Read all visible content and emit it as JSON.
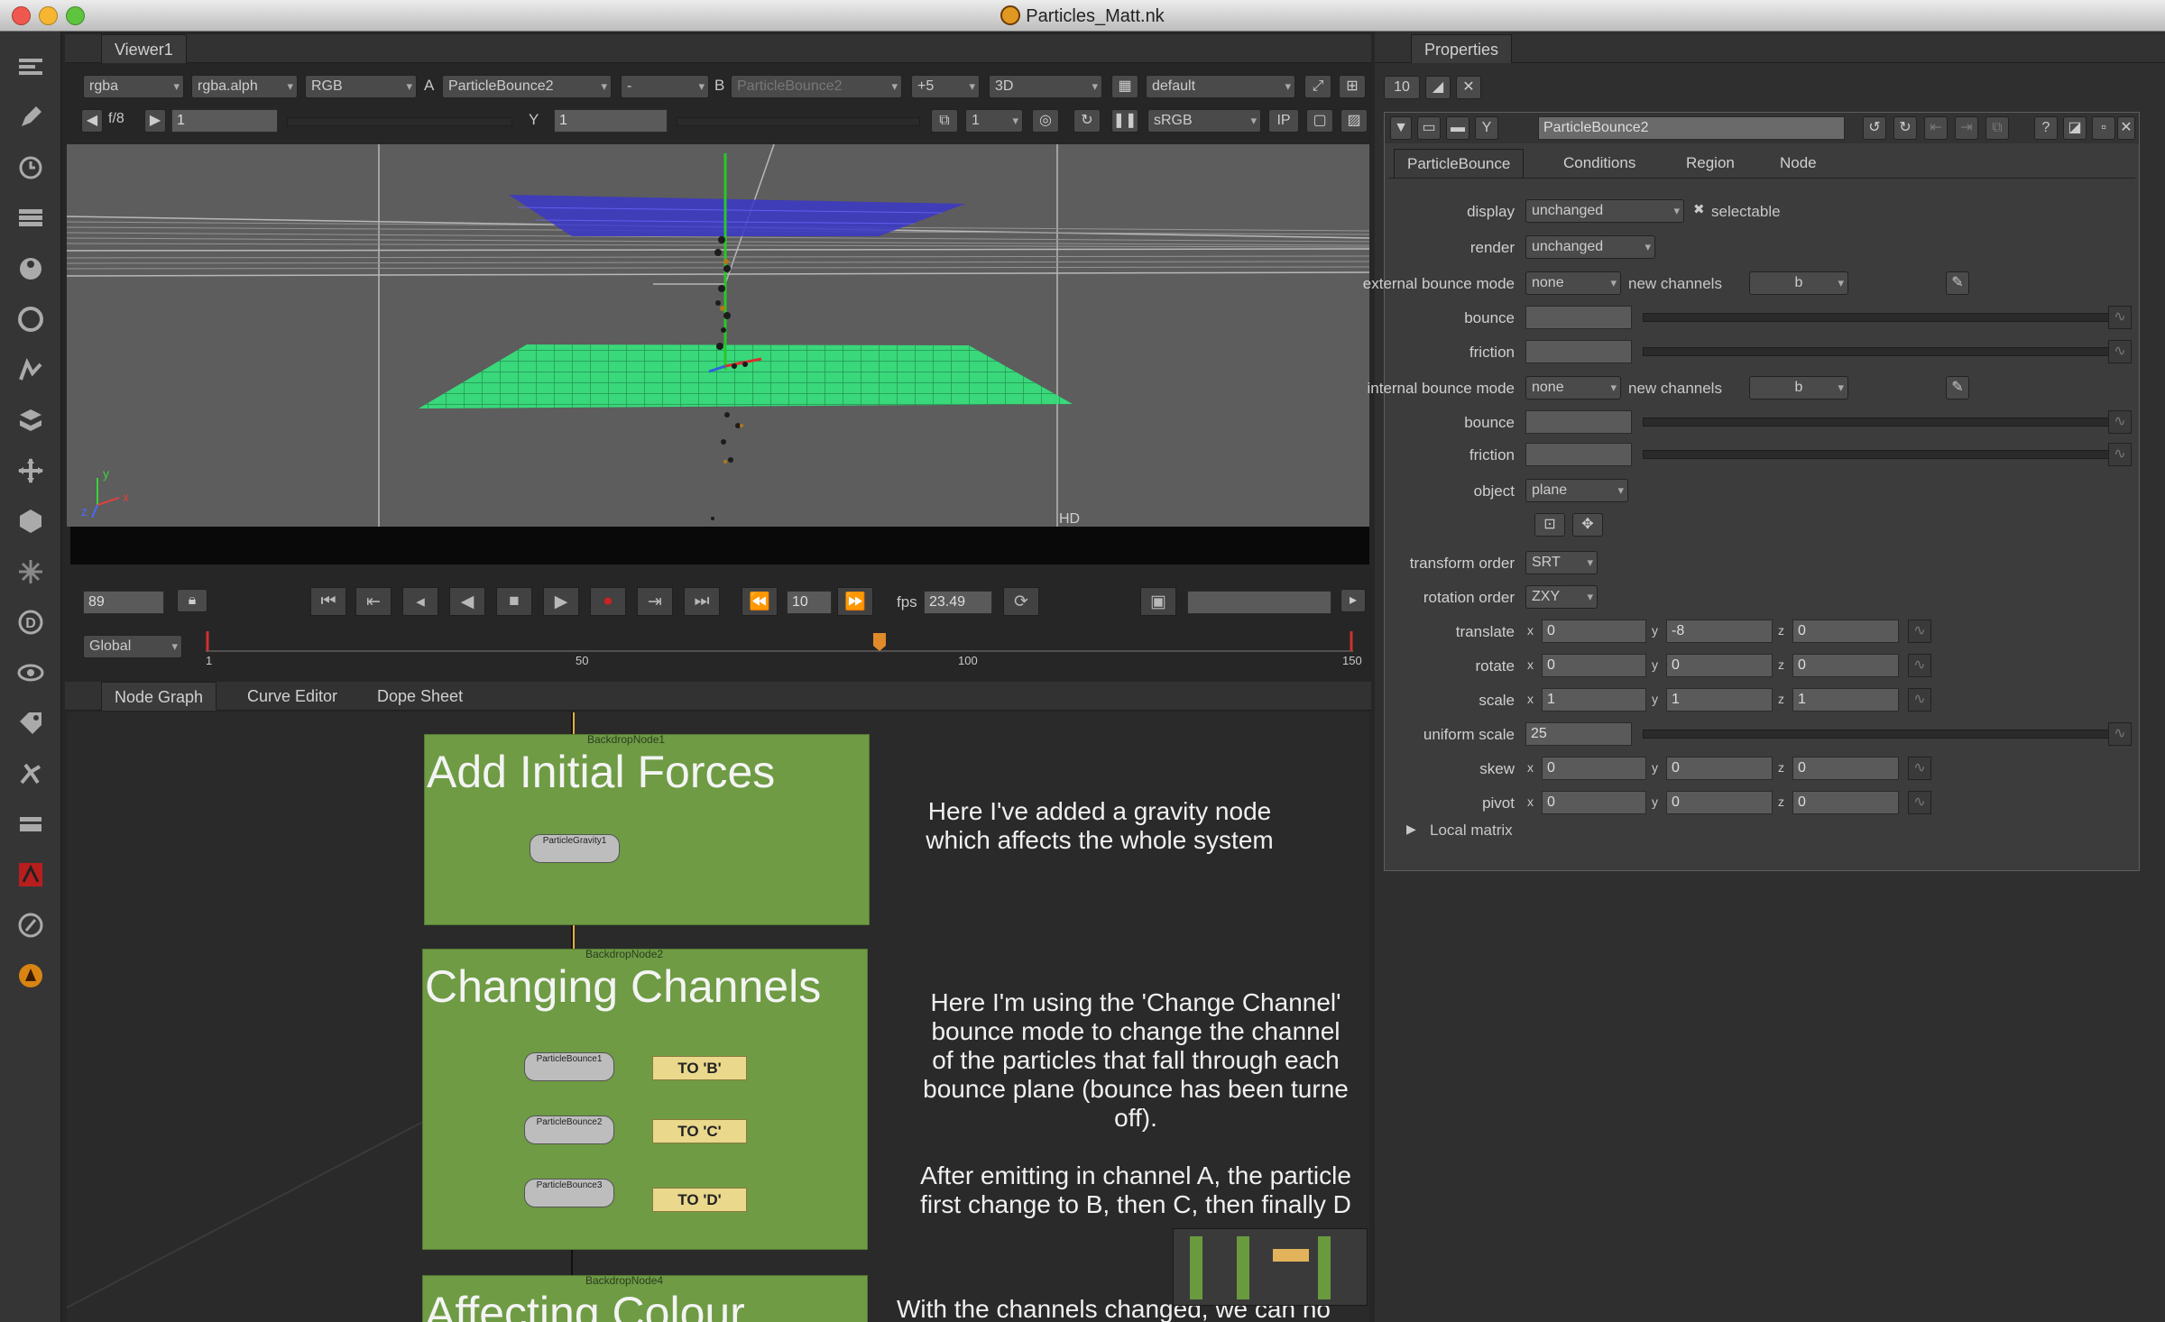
{
  "window": {
    "title": "Particles_Matt.nk"
  },
  "viewer": {
    "tab": "Viewer1",
    "channels": "rgba",
    "alpha_channel": "rgba.alph",
    "display": "RGB",
    "a_label": "A",
    "a_input": "ParticleBounce2",
    "compare": "-",
    "b_label": "B",
    "b_input": "ParticleBounce2",
    "zoom": "+5",
    "view_mode": "3D",
    "lut_preset": "default",
    "frame_fraction": "f/8",
    "gain": "1",
    "y_label": "Y",
    "gamma": "1",
    "proxy": "1",
    "colorspace": "sRGB",
    "ip_label": "IP",
    "format_label": "HD"
  },
  "timeline": {
    "current_frame": "89",
    "increment": "10",
    "fps_label": "fps",
    "fps": "23.49",
    "range": "Global",
    "ticks": [
      "1",
      "50",
      "100",
      "150"
    ]
  },
  "nodegraph": {
    "tabs": [
      "Node Graph",
      "Curve Editor",
      "Dope Sheet"
    ],
    "backdrops": [
      {
        "title": "Add Initial Forces",
        "label": "BackdropNode1"
      },
      {
        "title": "Changing Channels",
        "label": "BackdropNode2"
      },
      {
        "title": "Affecting Colour",
        "label": "BackdropNode4"
      }
    ],
    "tags": [
      "TO 'B'",
      "TO 'C'",
      "TO 'D'"
    ],
    "notes": {
      "gravity": "Here I've added a gravity node\nwhich affects the whole system",
      "channels": "Here I'm using the 'Change Channel'\nbounce mode to change the channel\nof the particles that fall through each\nbounce plane (bounce has been turne\noff).\n\nAfter emitting in channel A, the particle\nfirst change to B, then C, then finally D",
      "colour": "With the channels changed, we can no"
    },
    "small_nodes": [
      "ParticleGravity1",
      "ParticleBounce1",
      "ParticleBounce2",
      "ParticleBounce3"
    ]
  },
  "properties": {
    "tab": "Properties",
    "node_name": "ParticleBounce2",
    "node_tabs": [
      "ParticleBounce",
      "Conditions",
      "Region",
      "Node"
    ],
    "rows": {
      "display": {
        "label": "display",
        "value": "unchanged",
        "check": "selectable"
      },
      "render": {
        "label": "render",
        "value": "unchanged"
      },
      "ext_mode": {
        "label": "external bounce mode",
        "value": "none",
        "extra_label": "new channels",
        "extra_value": "b"
      },
      "bounce": {
        "label": "bounce"
      },
      "friction": {
        "label": "friction"
      },
      "int_mode": {
        "label": "internal bounce mode",
        "value": "none",
        "extra_label": "new channels",
        "extra_value": "b"
      },
      "bounce2": {
        "label": "bounce"
      },
      "friction2": {
        "label": "friction"
      },
      "object": {
        "label": "object",
        "value": "plane"
      },
      "transform_order": {
        "label": "transform order",
        "value": "SRT"
      },
      "rotation_order": {
        "label": "rotation order",
        "value": "ZXY"
      },
      "translate": {
        "label": "translate",
        "x": "0",
        "y": "-8",
        "z": "0"
      },
      "rotate": {
        "label": "rotate",
        "x": "0",
        "y": "0",
        "z": "0"
      },
      "scale": {
        "label": "scale",
        "x": "1",
        "y": "1",
        "z": "1"
      },
      "uniform_scale": {
        "label": "uniform scale",
        "value": "25"
      },
      "skew": {
        "label": "skew",
        "x": "0",
        "y": "0",
        "z": "0"
      },
      "pivot": {
        "label": "pivot",
        "x": "0",
        "y": "0",
        "z": "0"
      },
      "local_matrix": "Local matrix"
    }
  },
  "axis": {
    "x": "x",
    "y": "y",
    "z": "z"
  },
  "colors": {
    "backdrop": "#6e9b44",
    "grid_green": "#39d87a",
    "plane_blue": "#3a37c8",
    "selected_node": "#f0a54c"
  }
}
